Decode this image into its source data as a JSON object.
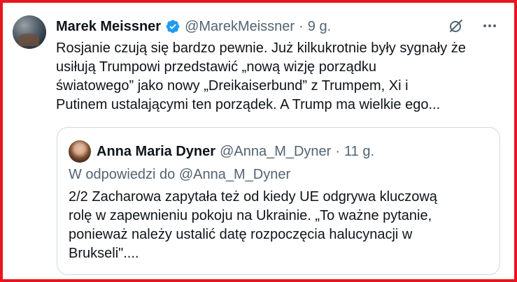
{
  "tweet": {
    "author_name": "Marek Meissner",
    "handle": "@MarekMeissner",
    "separator": "·",
    "time": "9 g.",
    "text": "Rosjanie czują się bardzo pewnie. Już kilkukrotnie były sygnały że\nusiłują  Trumpowi przedstawić „nową wizję porządku\nświatowego” jako nowy „Dreikaiserbund” z Trumpem, Xi i\nPutinem ustalającymi ten porządek. A Trump ma wielkie ego..."
  },
  "quoted_tweet": {
    "author_name": "Anna Maria Dyner",
    "handle": "@Anna_M_Dyner",
    "separator": "·",
    "time": "11 g.",
    "reply_to": "W odpowiedzi do @Anna_M_Dyner",
    "text": "2/2 Zacharowa zapytała też od kiedy UE odgrywa kluczową\nrolę w zapewnieniu pokoju na Ukrainie. „To ważne pytanie,\nponieważ należy ustalić datę rozpoczęcia halucynacji w\nBrukseli\"...."
  },
  "icons": {
    "verified": "verified-badge-icon",
    "grok": "grok-icon",
    "more": "more-horizontal-icon"
  },
  "colors": {
    "frame_border": "#e8161d",
    "verified_blue": "#1d9bf0",
    "secondary_text": "#536471",
    "primary_text": "#0f1419",
    "quote_border": "#cfd9de"
  }
}
